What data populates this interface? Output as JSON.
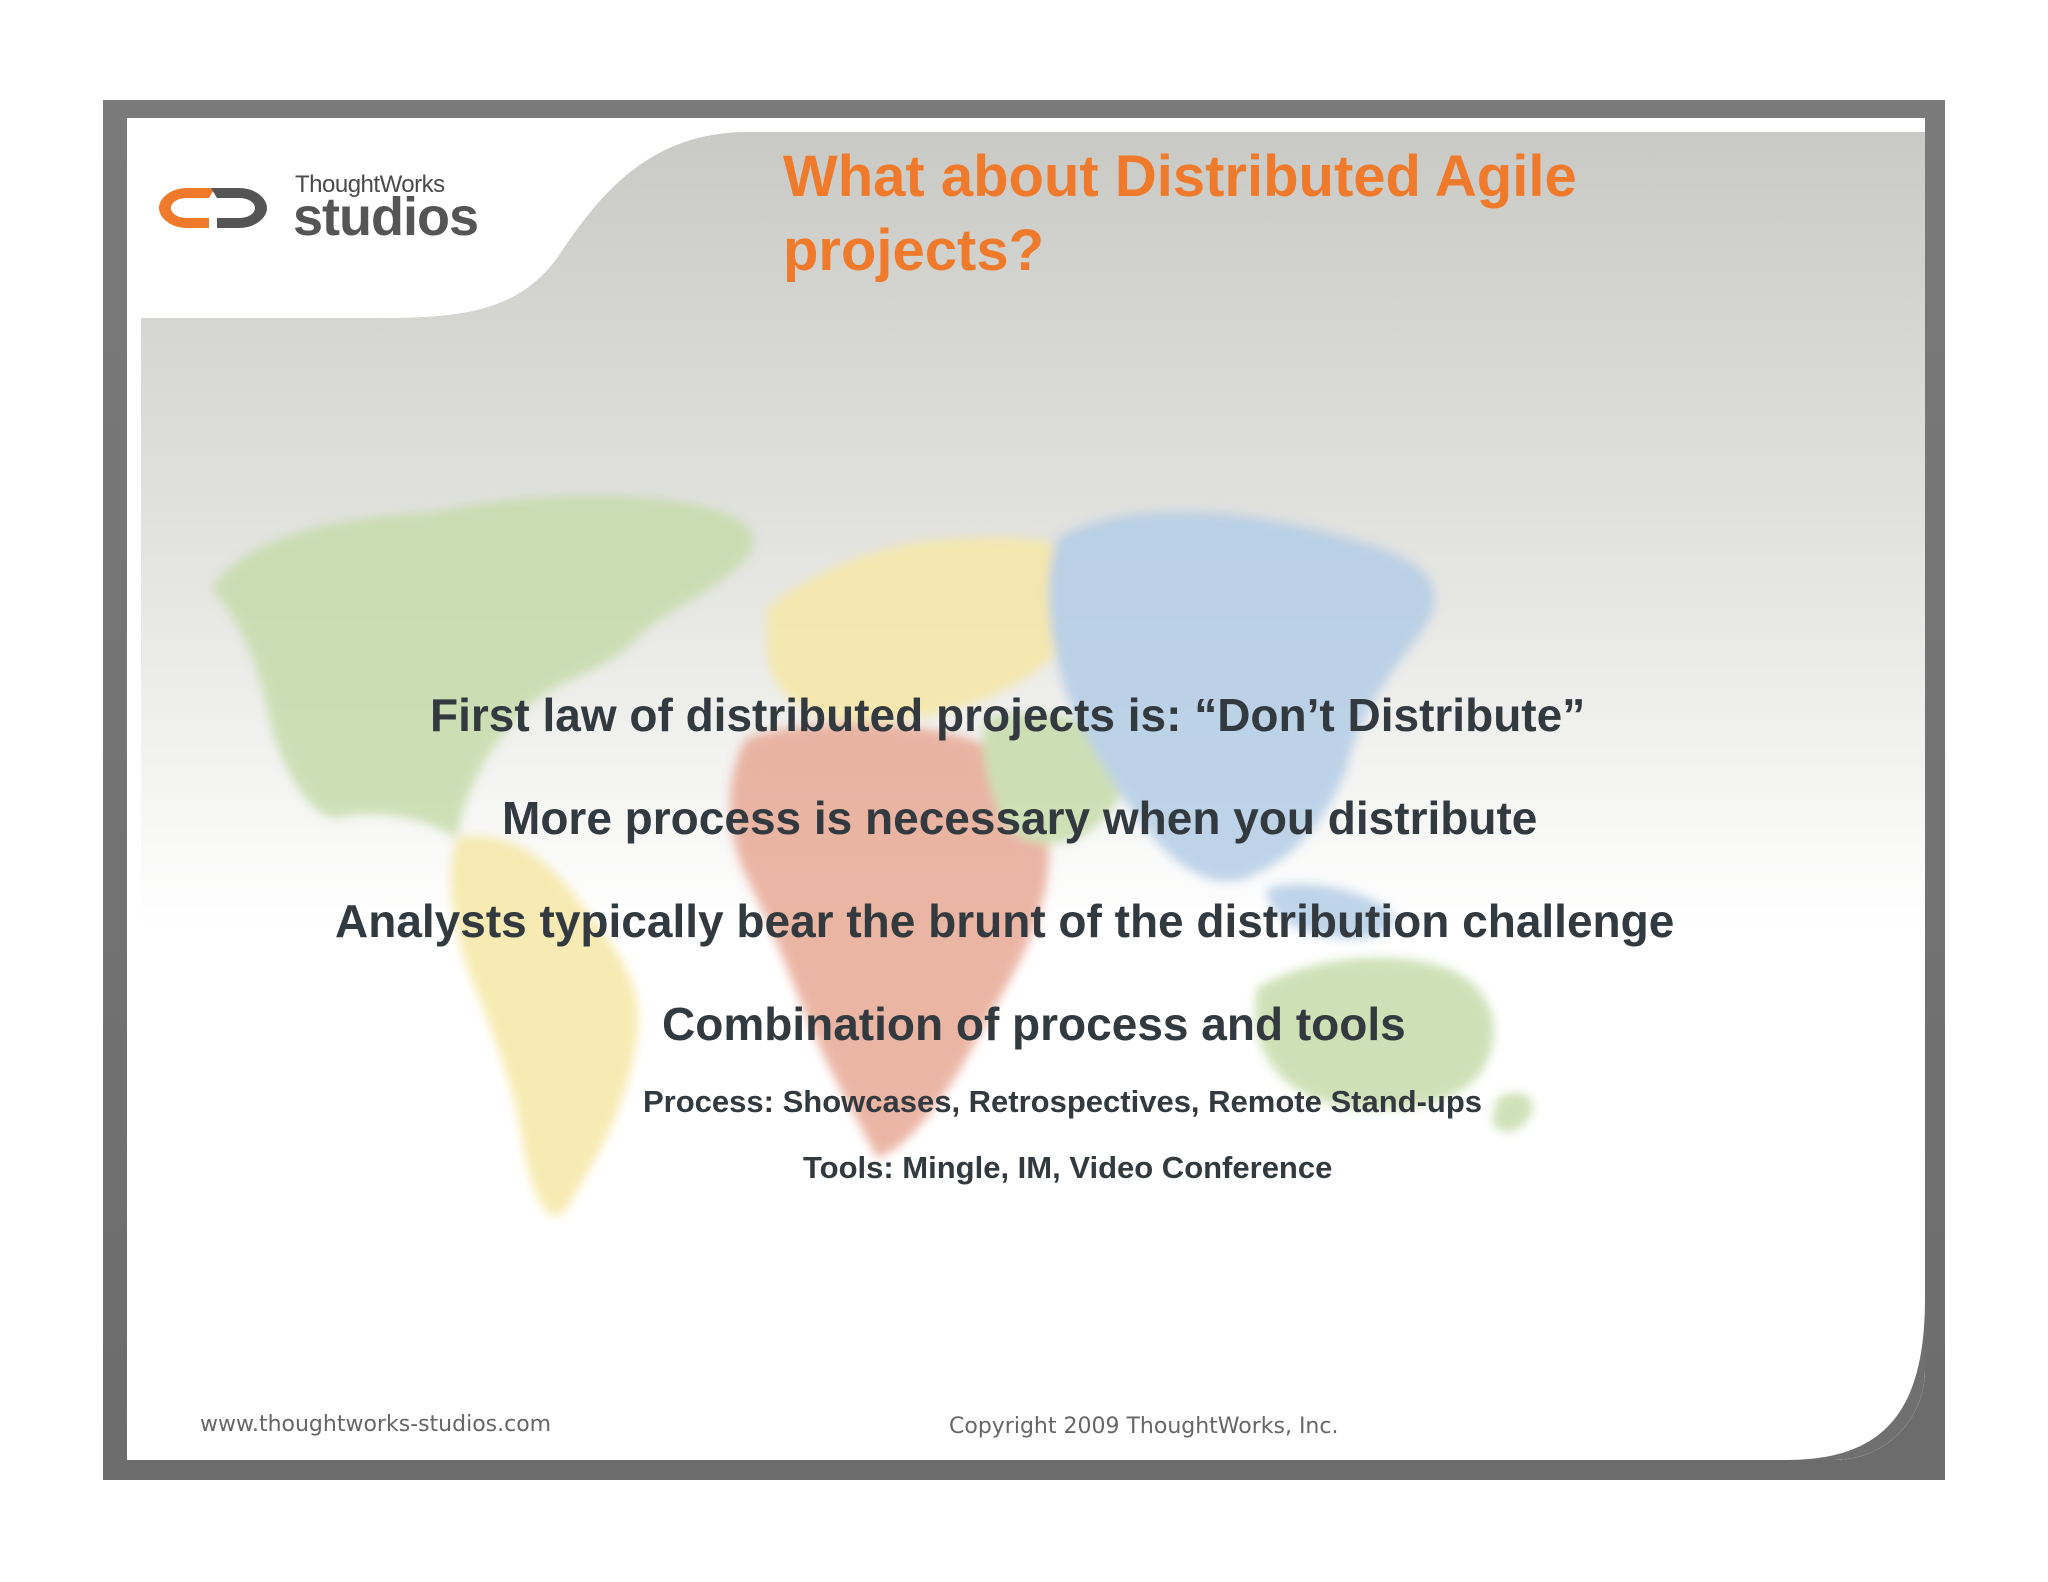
{
  "logo": {
    "company": "ThoughtWorks",
    "product": "studios"
  },
  "title": "What about Distributed Agile projects?",
  "title_lines": [
    "What about Distributed Agile",
    "projects?"
  ],
  "bullets": [
    "First law of distributed projects is:  “Don’t Distribute”",
    "More process is necessary when you distribute",
    "Analysts typically bear the brunt of the distribution challenge",
    "Combination of process and tools"
  ],
  "sub_bullets": [
    "Process:  Showcases, Retrospectives, Remote Stand-ups",
    "Tools:  Mingle, IM, Video Conference"
  ],
  "footer": {
    "url": "www.thoughtworks-studios.com",
    "copyright": "Copyright 2009 ThoughtWorks, Inc."
  },
  "colors": {
    "title": "#f07a2c",
    "logo_orange": "#f07a2c",
    "logo_gray": "#555555",
    "body_text": "#333a3f",
    "frame": "#707070",
    "map_green": "#bcd59a",
    "map_yellow": "#f6e49a",
    "map_blue": "#a9c4e2",
    "map_red": "#e39b88"
  }
}
